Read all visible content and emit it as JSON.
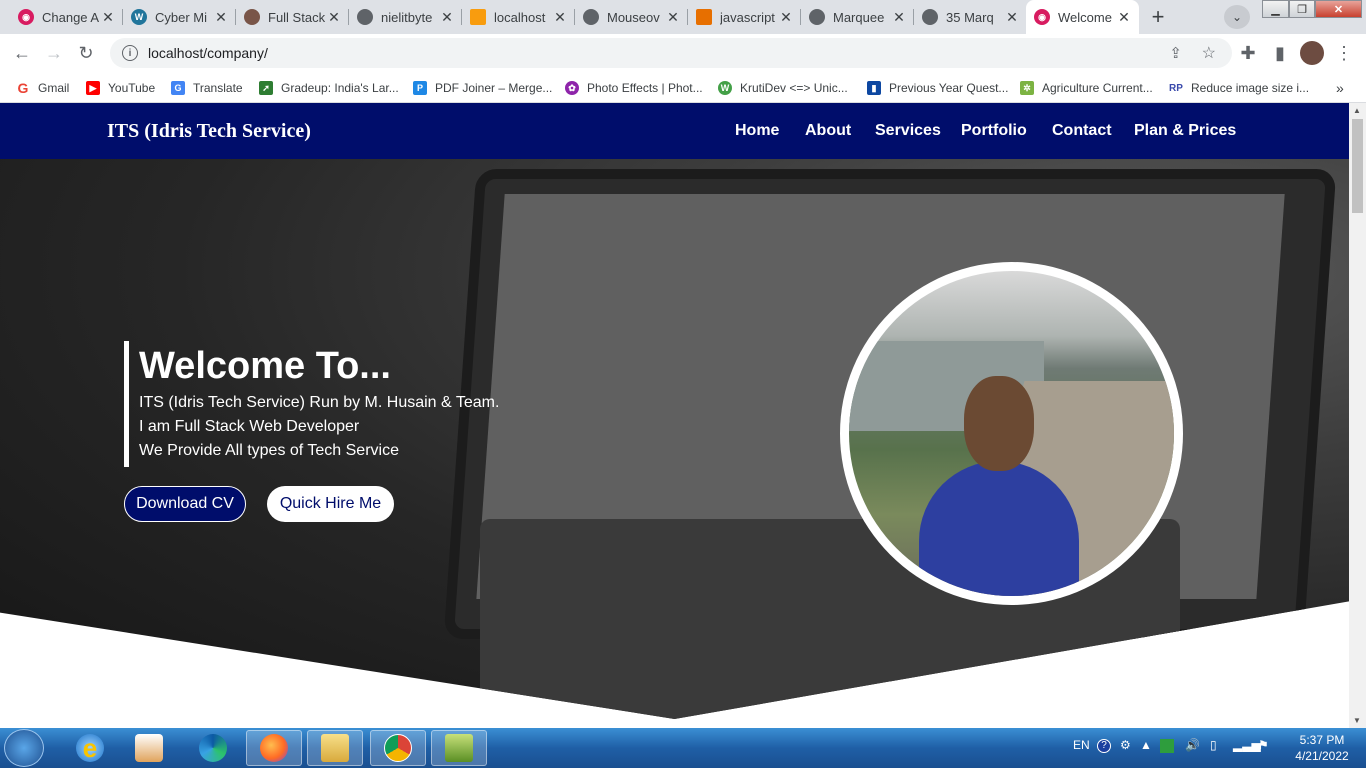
{
  "browser": {
    "tabs": [
      {
        "title": "Change A",
        "favicon": "app-icon",
        "color": "#d81b60"
      },
      {
        "title": "Cyber Mi",
        "favicon": "wordpress-icon",
        "color": "#21759b"
      },
      {
        "title": "Full Stack",
        "favicon": "person-icon",
        "color": "#795548"
      },
      {
        "title": "nielitbyte",
        "favicon": "globe-icon",
        "color": "#5f6368"
      },
      {
        "title": "localhost",
        "favicon": "pma-icon",
        "color": "#f89c0e"
      },
      {
        "title": "Mouseov",
        "favicon": "globe-icon",
        "color": "#5f6368"
      },
      {
        "title": "javascript",
        "favicon": "java-icon",
        "color": "#e76f00"
      },
      {
        "title": "Marquee",
        "favicon": "globe-icon",
        "color": "#5f6368"
      },
      {
        "title": "35 Marq",
        "favicon": "globe-icon",
        "color": "#5f6368"
      },
      {
        "title": "Welcome",
        "favicon": "app-icon",
        "color": "#d81b60"
      }
    ],
    "new_tab": "+",
    "url": "localhost/company/",
    "bookmarks": [
      {
        "label": "Gmail",
        "icon": "google-icon",
        "color": "#ea4335"
      },
      {
        "label": "YouTube",
        "icon": "youtube-icon",
        "color": "#ff0000"
      },
      {
        "label": "Translate",
        "icon": "translate-icon",
        "color": "#4285f4"
      },
      {
        "label": "Gradeup: India's Lar...",
        "icon": "rocket-icon",
        "color": "#2e7d32"
      },
      {
        "label": "PDF Joiner – Merge...",
        "icon": "pdf-icon",
        "color": "#1e88e5"
      },
      {
        "label": "Photo Effects | Phot...",
        "icon": "flower-icon",
        "color": "#8e24aa"
      },
      {
        "label": "KrutiDev <=> Unic...",
        "icon": "w-icon",
        "color": "#43a047"
      },
      {
        "label": "Previous Year Quest...",
        "icon": "book-icon",
        "color": "#0d47a1"
      },
      {
        "label": "Agriculture Current...",
        "icon": "plant-icon",
        "color": "#7cb342"
      },
      {
        "label": "Reduce image size i...",
        "icon": "rp-icon",
        "color": "#3949ab"
      }
    ]
  },
  "site": {
    "brand": "ITS (Idris Tech Service)",
    "nav": [
      "Home",
      "About",
      "Services",
      "Portfolio",
      "Contact",
      "Plan & Prices"
    ],
    "hero": {
      "heading": "Welcome To...",
      "lines": [
        "ITS (Idris Tech Service) Run by M. Husain & Team.",
        "I am Full Stack Web Developer",
        "We Provide All types of Tech Service"
      ],
      "download_label": "Download CV",
      "hire_label": "Quick Hire Me"
    },
    "colors": {
      "primary": "#000d6b"
    }
  },
  "taskbar": {
    "language": "EN",
    "time": "5:37 PM",
    "date": "4/21/2022"
  }
}
